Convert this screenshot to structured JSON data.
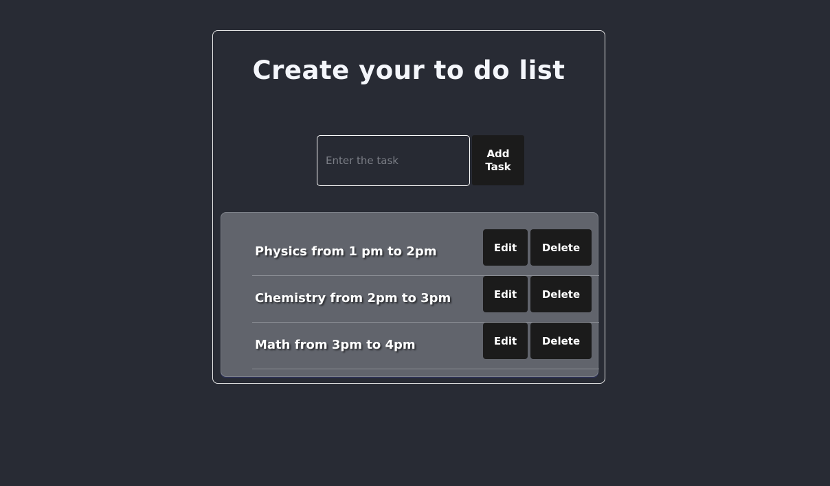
{
  "header": {
    "title": "Create your to do list"
  },
  "task_form": {
    "input_value": "",
    "input_placeholder": "Enter the task",
    "add_button_label": "Add Task"
  },
  "tasks": [
    {
      "text": "Physics from 1 pm to 2pm",
      "edit_label": "Edit",
      "delete_label": "Delete"
    },
    {
      "text": "Chemistry from 2pm to 3pm",
      "edit_label": "Edit",
      "delete_label": "Delete"
    },
    {
      "text": "Math from 3pm to 4pm",
      "edit_label": "Edit",
      "delete_label": "Delete"
    }
  ],
  "colors": {
    "background": "#282b34",
    "button": "#1b1b1b",
    "list_panel": "#61646c",
    "card_border": "#e6e6e6"
  }
}
